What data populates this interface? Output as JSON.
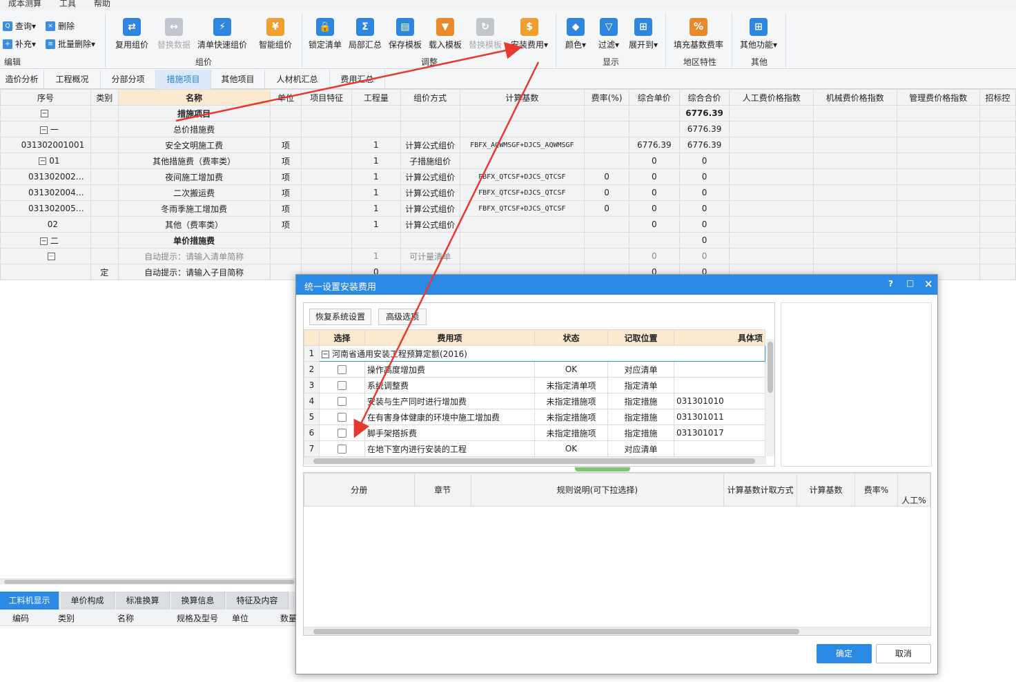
{
  "menu": [
    "成本测算",
    "工具",
    "帮助"
  ],
  "ribbon": {
    "edit": {
      "query": "查询",
      "delete": "删除",
      "supplement": "补充",
      "batch_delete": "批量删除",
      "label": "编辑"
    },
    "group": {
      "reuse": "复用组价",
      "replace_data": "替换数据",
      "quick_group": "清单快速组价",
      "smart_group": "智能组价",
      "label": "组价"
    },
    "adjust": {
      "lock": "锁定清单",
      "partial_sum": "局部汇总",
      "save_tpl": "保存模板",
      "load_tpl": "载入模板",
      "replace_tpl": "替换模板",
      "install_fee": "安装费用",
      "label": "调整"
    },
    "display": {
      "color": "颜色",
      "filter": "过滤",
      "expand": "展开到",
      "label": "显示"
    },
    "region": {
      "fill_rate": "填充基数费率",
      "label": "地区特性"
    },
    "other": {
      "other_func": "其他功能",
      "label": "其他"
    }
  },
  "tabs": [
    "造价分析",
    "工程概况",
    "分部分项",
    "措施项目",
    "其他项目",
    "人材机汇总",
    "费用汇总"
  ],
  "columns": [
    "序号",
    "类别",
    "名称",
    "单位",
    "项目特征",
    "工程量",
    "组价方式",
    "计算基数",
    "费率(%)",
    "综合单价",
    "综合合价",
    "人工费价格指数",
    "机械费价格指数",
    "管理费价格指数",
    "招标控"
  ],
  "rows": [
    {
      "no": "",
      "cat": "",
      "name": "措施项目",
      "unit": "",
      "qty": "",
      "method": "",
      "base": "",
      "rate": "",
      "price": "",
      "total": "6776.39"
    },
    {
      "no": "一",
      "cat": "",
      "name": "总价措施费",
      "unit": "",
      "qty": "",
      "method": "",
      "base": "",
      "rate": "",
      "price": "",
      "total": "6776.39"
    },
    {
      "no": "031302001001",
      "cat": "",
      "name": "安全文明施工费",
      "unit": "项",
      "qty": "1",
      "method": "计算公式组价",
      "base": "FBFX_AQWMSGF+DJCS_AQWMSGF",
      "rate": "",
      "price": "6776.39",
      "total": "6776.39"
    },
    {
      "no": "01",
      "cat": "",
      "name": "其他措施费（费率类）",
      "unit": "项",
      "qty": "1",
      "method": "子措施组价",
      "base": "",
      "rate": "",
      "price": "0",
      "total": "0"
    },
    {
      "no": "031302002…",
      "cat": "",
      "name": "夜间施工增加费",
      "unit": "项",
      "qty": "1",
      "method": "计算公式组价",
      "base": "FBFX_QTCSF+DJCS_QTCSF",
      "rate": "0",
      "price": "0",
      "total": "0"
    },
    {
      "no": "031302004…",
      "cat": "",
      "name": "二次搬运费",
      "unit": "项",
      "qty": "1",
      "method": "计算公式组价",
      "base": "FBFX_QTCSF+DJCS_QTCSF",
      "rate": "0",
      "price": "0",
      "total": "0"
    },
    {
      "no": "031302005…",
      "cat": "",
      "name": "冬雨季施工增加费",
      "unit": "项",
      "qty": "1",
      "method": "计算公式组价",
      "base": "FBFX_QTCSF+DJCS_QTCSF",
      "rate": "0",
      "price": "0",
      "total": "0"
    },
    {
      "no": "02",
      "cat": "",
      "name": "其他（费率类）",
      "unit": "项",
      "qty": "1",
      "method": "计算公式组价",
      "base": "",
      "rate": "",
      "price": "0",
      "total": "0"
    },
    {
      "no": "二",
      "cat": "",
      "name": "单价措施费",
      "unit": "",
      "qty": "",
      "method": "",
      "base": "",
      "rate": "",
      "price": "",
      "total": "0"
    },
    {
      "no": "",
      "cat": "",
      "name": "自动提示：请输入清单简称",
      "unit": "",
      "qty": "1",
      "method": "可计量清单",
      "base": "",
      "rate": "",
      "price": "0",
      "total": "0"
    },
    {
      "no": "",
      "cat": "定",
      "name": "自动提示：请输入子目简称",
      "unit": "",
      "qty": "0",
      "method": "",
      "base": "",
      "rate": "",
      "price": "0",
      "total": "0"
    }
  ],
  "bottom_tabs": [
    "工料机显示",
    "单价构成",
    "标准换算",
    "换算信息",
    "特征及内容"
  ],
  "bottom_columns": [
    "编码",
    "类别",
    "名称",
    "规格及型号",
    "单位",
    "数量"
  ],
  "dialog": {
    "title": "统一设置安装费用",
    "restore": "恢复系统设置",
    "advanced": "高级选项",
    "headers": [
      "选择",
      "费用项",
      "状态",
      "记取位置",
      "具体项"
    ],
    "group_row": {
      "idx": "1",
      "name": "河南省通用安装工程预算定额(2016)"
    },
    "items": [
      {
        "idx": "2",
        "name": "操作高度增加费",
        "status": "OK",
        "pos": "对应清单",
        "detail": ""
      },
      {
        "idx": "3",
        "name": "系统调整费",
        "status": "未指定清单项",
        "pos": "指定清单",
        "detail": ""
      },
      {
        "idx": "4",
        "name": "安装与生产同时进行增加费",
        "status": "未指定措施项",
        "pos": "指定措施",
        "detail": "031301010"
      },
      {
        "idx": "5",
        "name": "在有害身体健康的环境中施工增加费",
        "status": "未指定措施项",
        "pos": "指定措施",
        "detail": "031301011"
      },
      {
        "idx": "6",
        "name": "脚手架搭拆费",
        "status": "未指定措施项",
        "pos": "指定措施",
        "detail": "031301017"
      },
      {
        "idx": "7",
        "name": "在地下室内进行安装的工程",
        "status": "OK",
        "pos": "对应清单",
        "detail": ""
      }
    ],
    "lower_headers": [
      "分册",
      "章节",
      "规则说明(可下拉选择)",
      "计算基数计取方式",
      "计算基数",
      "费率%",
      "人工%"
    ],
    "ok": "确定",
    "cancel": "取消"
  },
  "colors": {
    "accent": "#2b8ae6",
    "arrow": "#e8392e"
  }
}
